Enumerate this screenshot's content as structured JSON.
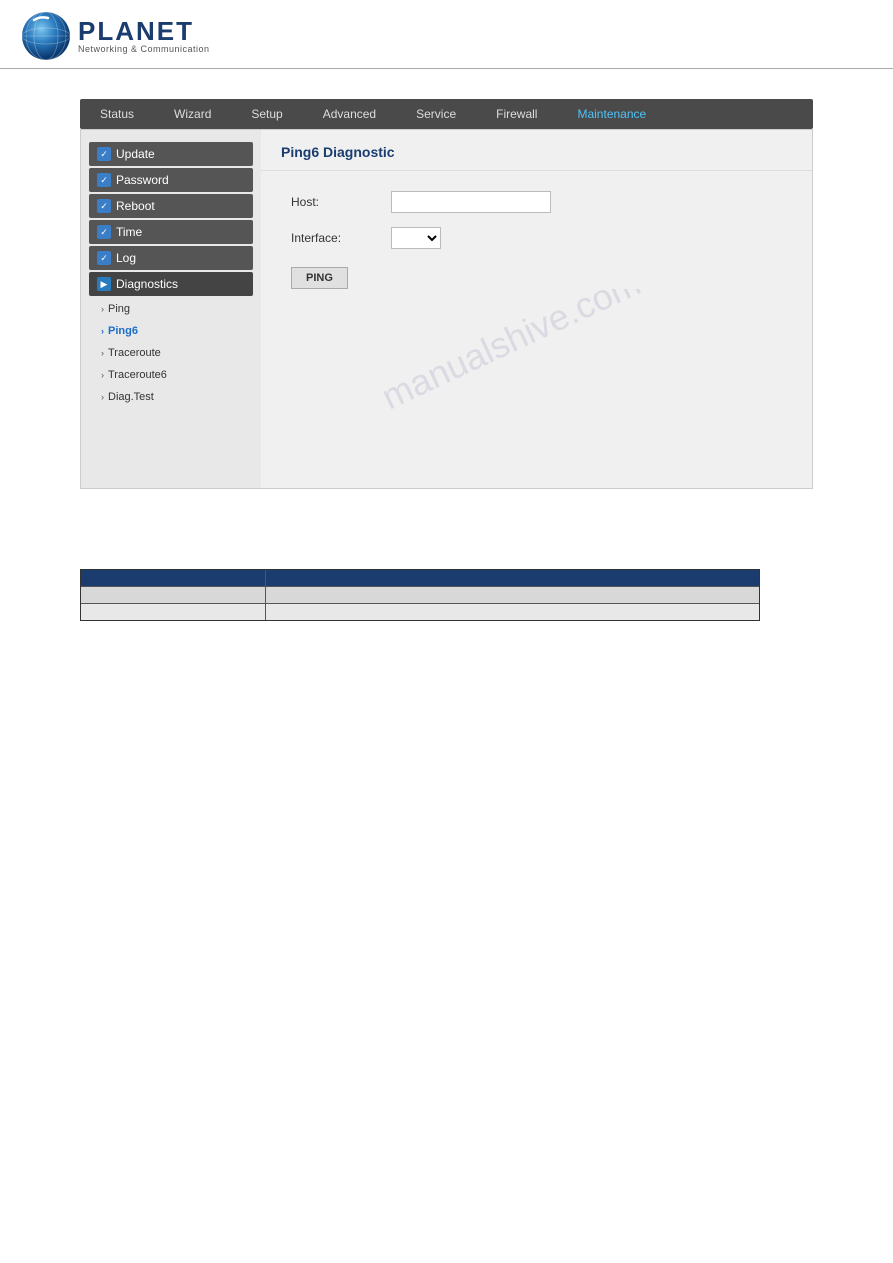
{
  "header": {
    "logo_planet": "PLANET",
    "logo_subtitle": "Networking & Communication"
  },
  "navbar": {
    "items": [
      {
        "id": "status",
        "label": "Status",
        "active": false
      },
      {
        "id": "wizard",
        "label": "Wizard",
        "active": false
      },
      {
        "id": "setup",
        "label": "Setup",
        "active": false
      },
      {
        "id": "advanced",
        "label": "Advanced",
        "active": false
      },
      {
        "id": "service",
        "label": "Service",
        "active": false
      },
      {
        "id": "firewall",
        "label": "Firewall",
        "active": false
      },
      {
        "id": "maintenance",
        "label": "Maintenance",
        "active": true
      }
    ]
  },
  "sidebar": {
    "menu_items": [
      {
        "id": "update",
        "label": "Update",
        "has_check": true
      },
      {
        "id": "password",
        "label": "Password",
        "has_check": true
      },
      {
        "id": "reboot",
        "label": "Reboot",
        "has_check": true
      },
      {
        "id": "time",
        "label": "Time",
        "has_check": true
      },
      {
        "id": "log",
        "label": "Log",
        "has_check": true
      },
      {
        "id": "diagnostics",
        "label": "Diagnostics",
        "has_check": true,
        "expanded": true
      }
    ],
    "sub_items": [
      {
        "id": "ping",
        "label": "Ping",
        "active": false
      },
      {
        "id": "ping6",
        "label": "Ping6",
        "active": true
      },
      {
        "id": "traceroute",
        "label": "Traceroute",
        "active": false
      },
      {
        "id": "traceroute6",
        "label": "Traceroute6",
        "active": false
      },
      {
        "id": "diag-test",
        "label": "Diag.Test",
        "active": false
      }
    ]
  },
  "main_panel": {
    "title": "Ping6 Diagnostic",
    "form": {
      "host_label": "Host:",
      "host_placeholder": "",
      "interface_label": "Interface:",
      "interface_options": [
        ""
      ],
      "ping_button": "PING"
    }
  },
  "bottom_table": {
    "header": {
      "col1": "",
      "col2": ""
    },
    "rows": [
      {
        "col1": "",
        "col2": ""
      },
      {
        "col1": "",
        "col2": ""
      }
    ]
  },
  "watermark": {
    "text": "manualshive.com"
  }
}
